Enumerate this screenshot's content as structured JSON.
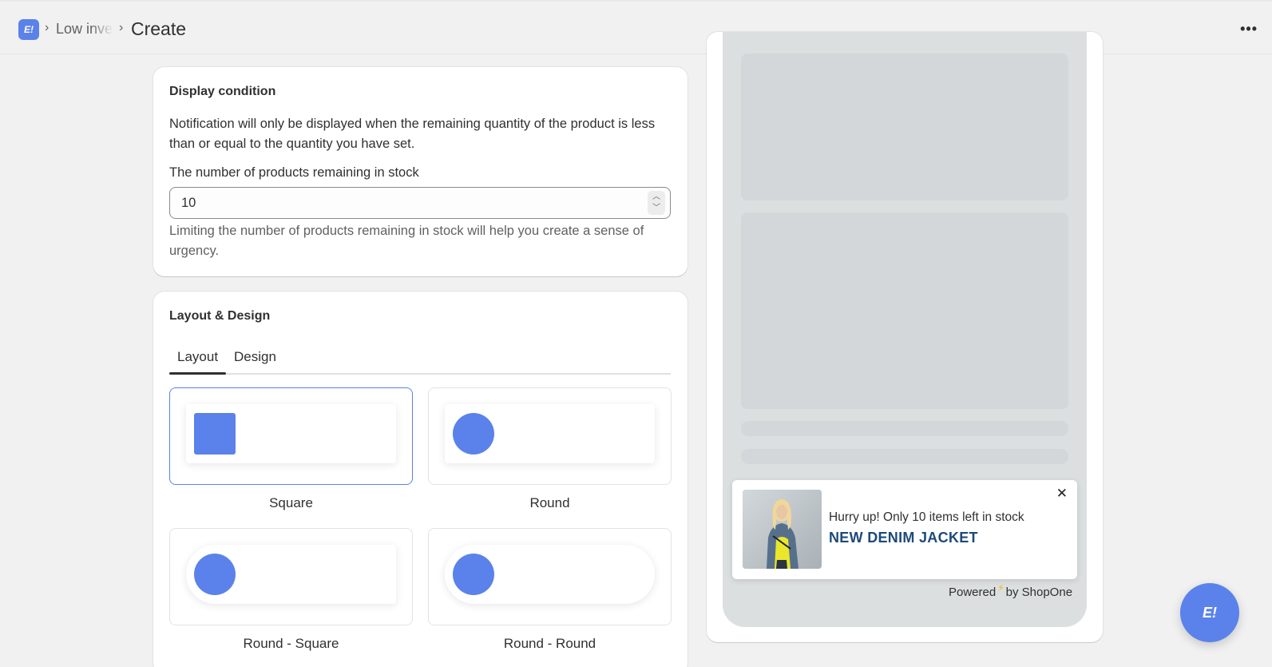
{
  "header": {
    "app_icon": "app-logo-icon",
    "logo_text": "E!",
    "breadcrumb_parent": "Low inventory",
    "title": "Create",
    "more_icon": "more-horizontal-icon",
    "more_glyph": "•••"
  },
  "display_condition": {
    "title": "Display condition",
    "description": "Notification will only be displayed when the remaining quantity of the product is less than or equal to the quantity you have set.",
    "field_label": "The number of products remaining in stock",
    "field_value": "10",
    "help_text": "Limiting the number of products remaining in stock will help you create a sense of urgency."
  },
  "layout_design": {
    "title": "Layout & Design",
    "tabs": [
      {
        "label": "Layout",
        "selected": true
      },
      {
        "label": "Design",
        "selected": false
      }
    ],
    "options": [
      {
        "label": "Square",
        "selected": true
      },
      {
        "label": "Round",
        "selected": false
      },
      {
        "label": "Round - Square",
        "selected": false
      },
      {
        "label": "Round - Round",
        "selected": false
      }
    ]
  },
  "preview": {
    "notification": {
      "message": "Hurry up! Only 10 items left in stock",
      "product_name": "NEW DENIM JACKET",
      "close_glyph": "✕"
    },
    "powered_prefix": "Powered",
    "powered_suffix": "by ShopOne"
  },
  "colors": {
    "accent": "#5b82ea",
    "product_name": "#1d4a7a",
    "bolt": "#f5b400"
  }
}
